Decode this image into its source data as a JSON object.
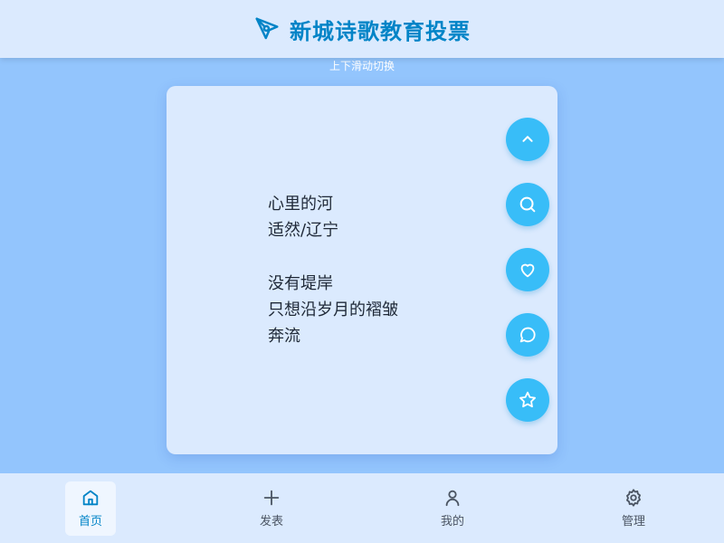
{
  "header": {
    "title": "新城诗歌教育投票",
    "logo_icon": "pen-nib-icon"
  },
  "hint": "上下滑动切换",
  "poem": {
    "title": "心里的河",
    "author": "适然/辽宁",
    "lines": [
      "",
      "没有堤岸",
      "只想沿岁月的褶皱",
      "奔流"
    ]
  },
  "actions": [
    {
      "icon": "chevron-up-icon"
    },
    {
      "icon": "search-icon"
    },
    {
      "icon": "heart-icon"
    },
    {
      "icon": "comment-icon"
    },
    {
      "icon": "star-icon"
    }
  ],
  "nav": {
    "items": [
      {
        "label": "首页",
        "icon": "home-icon",
        "active": true
      },
      {
        "label": "发表",
        "icon": "plus-icon",
        "active": false
      },
      {
        "label": "我的",
        "icon": "user-icon",
        "active": false
      },
      {
        "label": "管理",
        "icon": "gear-icon",
        "active": false
      }
    ]
  },
  "colors": {
    "accent": "#0284c7",
    "fab": "#38bdf8",
    "page_bg": "#93c5fd",
    "surface": "#dbeafe"
  }
}
